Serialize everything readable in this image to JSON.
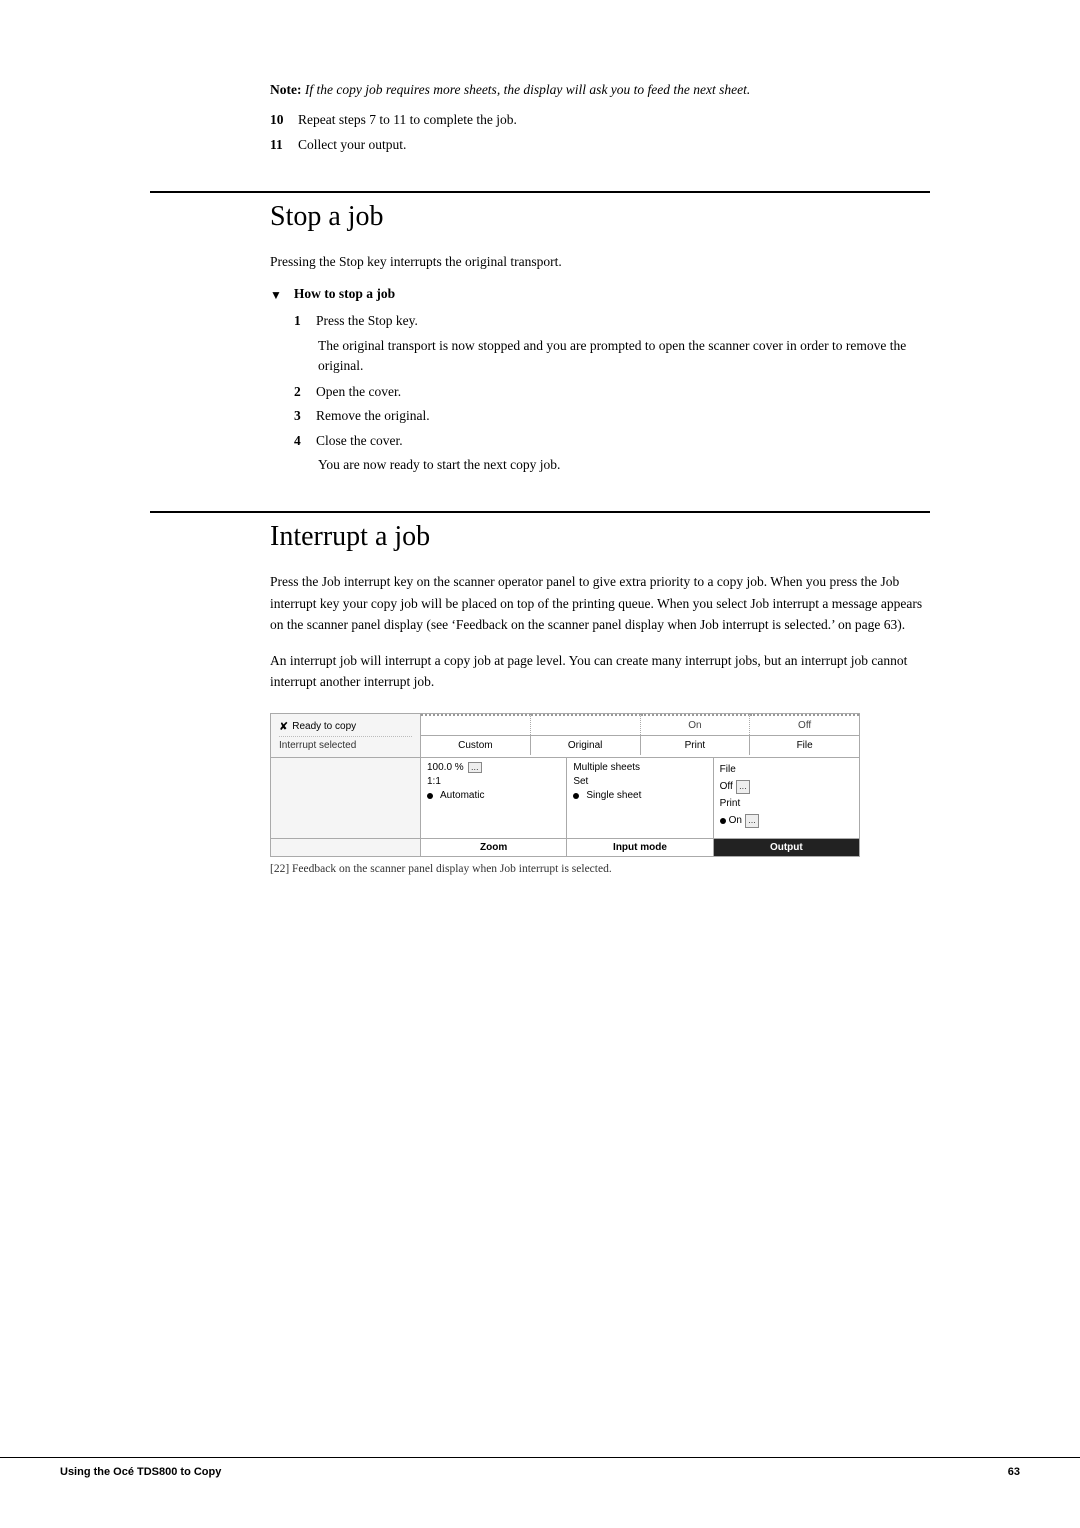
{
  "note": {
    "label": "Note:",
    "text": "If the copy job requires more sheets, the display will ask you to feed the next sheet."
  },
  "steps_top": [
    {
      "num": "10",
      "text": "Repeat steps 7 to 11 to complete the job."
    },
    {
      "num": "11",
      "text": "Collect your output."
    }
  ],
  "section_stop": {
    "title": "Stop a job",
    "intro": "Pressing the Stop key interrupts the original transport.",
    "subsection_label": "How to stop a job",
    "steps": [
      {
        "num": "1",
        "text": "Press the Stop key.",
        "sub_text": "The original transport is now stopped and you are prompted to open the scanner cover in order to remove the original."
      },
      {
        "num": "2",
        "text": "Open the cover.",
        "sub_text": ""
      },
      {
        "num": "3",
        "text": "Remove the original.",
        "sub_text": ""
      },
      {
        "num": "4",
        "text": "Close the cover.",
        "sub_text": "You are now ready to start the next copy job."
      }
    ]
  },
  "section_interrupt": {
    "title": "Interrupt a job",
    "para1": "Press the Job interrupt key on the scanner operator panel to give extra priority to a copy job. When you press the Job interrupt key your copy job will be placed on top of the printing queue. When you select Job interrupt a message appears on the scanner panel display (see ‘Feedback on the scanner panel display when Job interrupt is selected.’ on page 63).",
    "para2": "An interrupt job will interrupt a copy job at page level. You can create many interrupt jobs, but an interrupt job cannot interrupt another interrupt job."
  },
  "diagram": {
    "ready_label": "Ready to copy",
    "interrupt_label": "Interrupt selected",
    "tabs": [
      {
        "top": "",
        "label": "Custom"
      },
      {
        "top": "",
        "label": "Original"
      },
      {
        "top": "On",
        "label": "Print"
      },
      {
        "top": "Off",
        "label": "File"
      }
    ],
    "zoom": {
      "footer": "Zoom",
      "rows": [
        {
          "val": "100.0 %",
          "has_adj": true
        },
        {
          "val": "1:1",
          "has_adj": false
        },
        {
          "val": "Automatic",
          "has_dot": true,
          "dot": true
        }
      ]
    },
    "input": {
      "footer": "Input mode",
      "rows": [
        {
          "val": "Multiple sheets",
          "has_adj": false
        },
        {
          "val": "Set",
          "has_adj": false
        },
        {
          "val": "Single sheet",
          "has_dot": true
        }
      ]
    },
    "output": {
      "footer": "Output",
      "rows": [
        {
          "val": "File",
          "has_adj": false
        },
        {
          "val": "Off",
          "has_adj": true
        },
        {
          "val": "Print",
          "has_adj": false
        },
        {
          "val": "On",
          "has_dot": true,
          "has_adj_right": true
        }
      ]
    },
    "caption": "[22] Feedback on the scanner panel display when Job interrupt is selected."
  },
  "footer": {
    "title": "Using the Océ TDS800 to Copy",
    "page_number": "63"
  }
}
